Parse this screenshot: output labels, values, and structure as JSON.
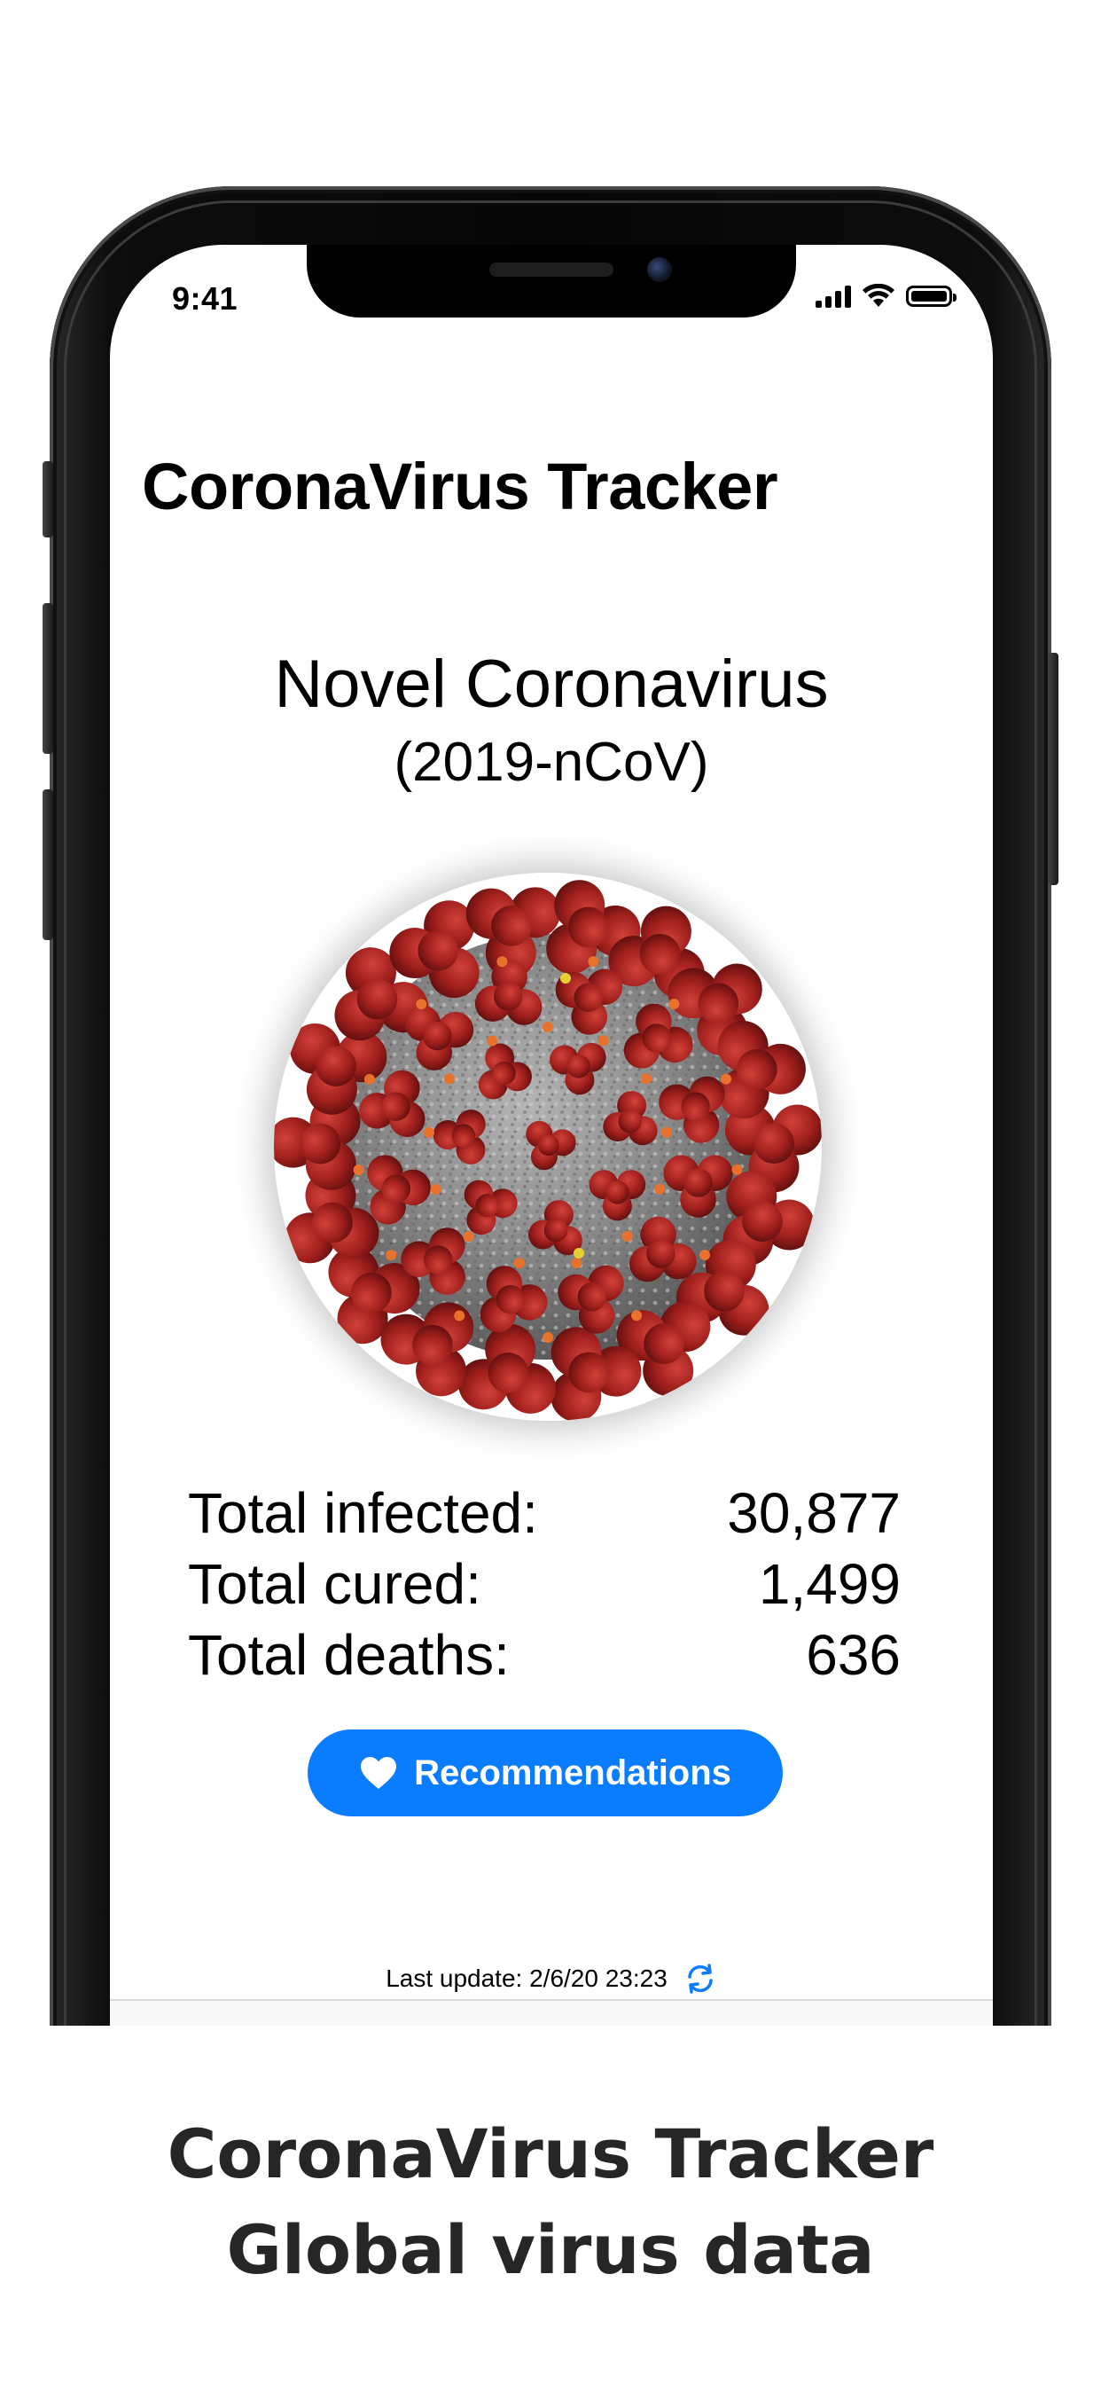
{
  "status_bar": {
    "time": "9:41"
  },
  "app": {
    "title": "CoronaVirus Tracker",
    "headline": "Novel Coronavirus",
    "subheadline": "(2019-nCoV)",
    "virus_image": "coronavirus-illustration",
    "stats": [
      {
        "label": "Total infected:",
        "value": "30,877"
      },
      {
        "label": "Total cured:",
        "value": "1,499"
      },
      {
        "label": "Total deaths:",
        "value": "636"
      }
    ],
    "recommendations_button": {
      "label": "Recommendations",
      "icon": "heart-icon",
      "color": "#0a7cff"
    },
    "last_update": {
      "text": "Last update: 2/6/20 23:23",
      "icon": "refresh-icon",
      "icon_color": "#0a7cff"
    }
  },
  "caption": {
    "line1": "CoronaVirus Tracker",
    "line2": "Global virus data"
  }
}
